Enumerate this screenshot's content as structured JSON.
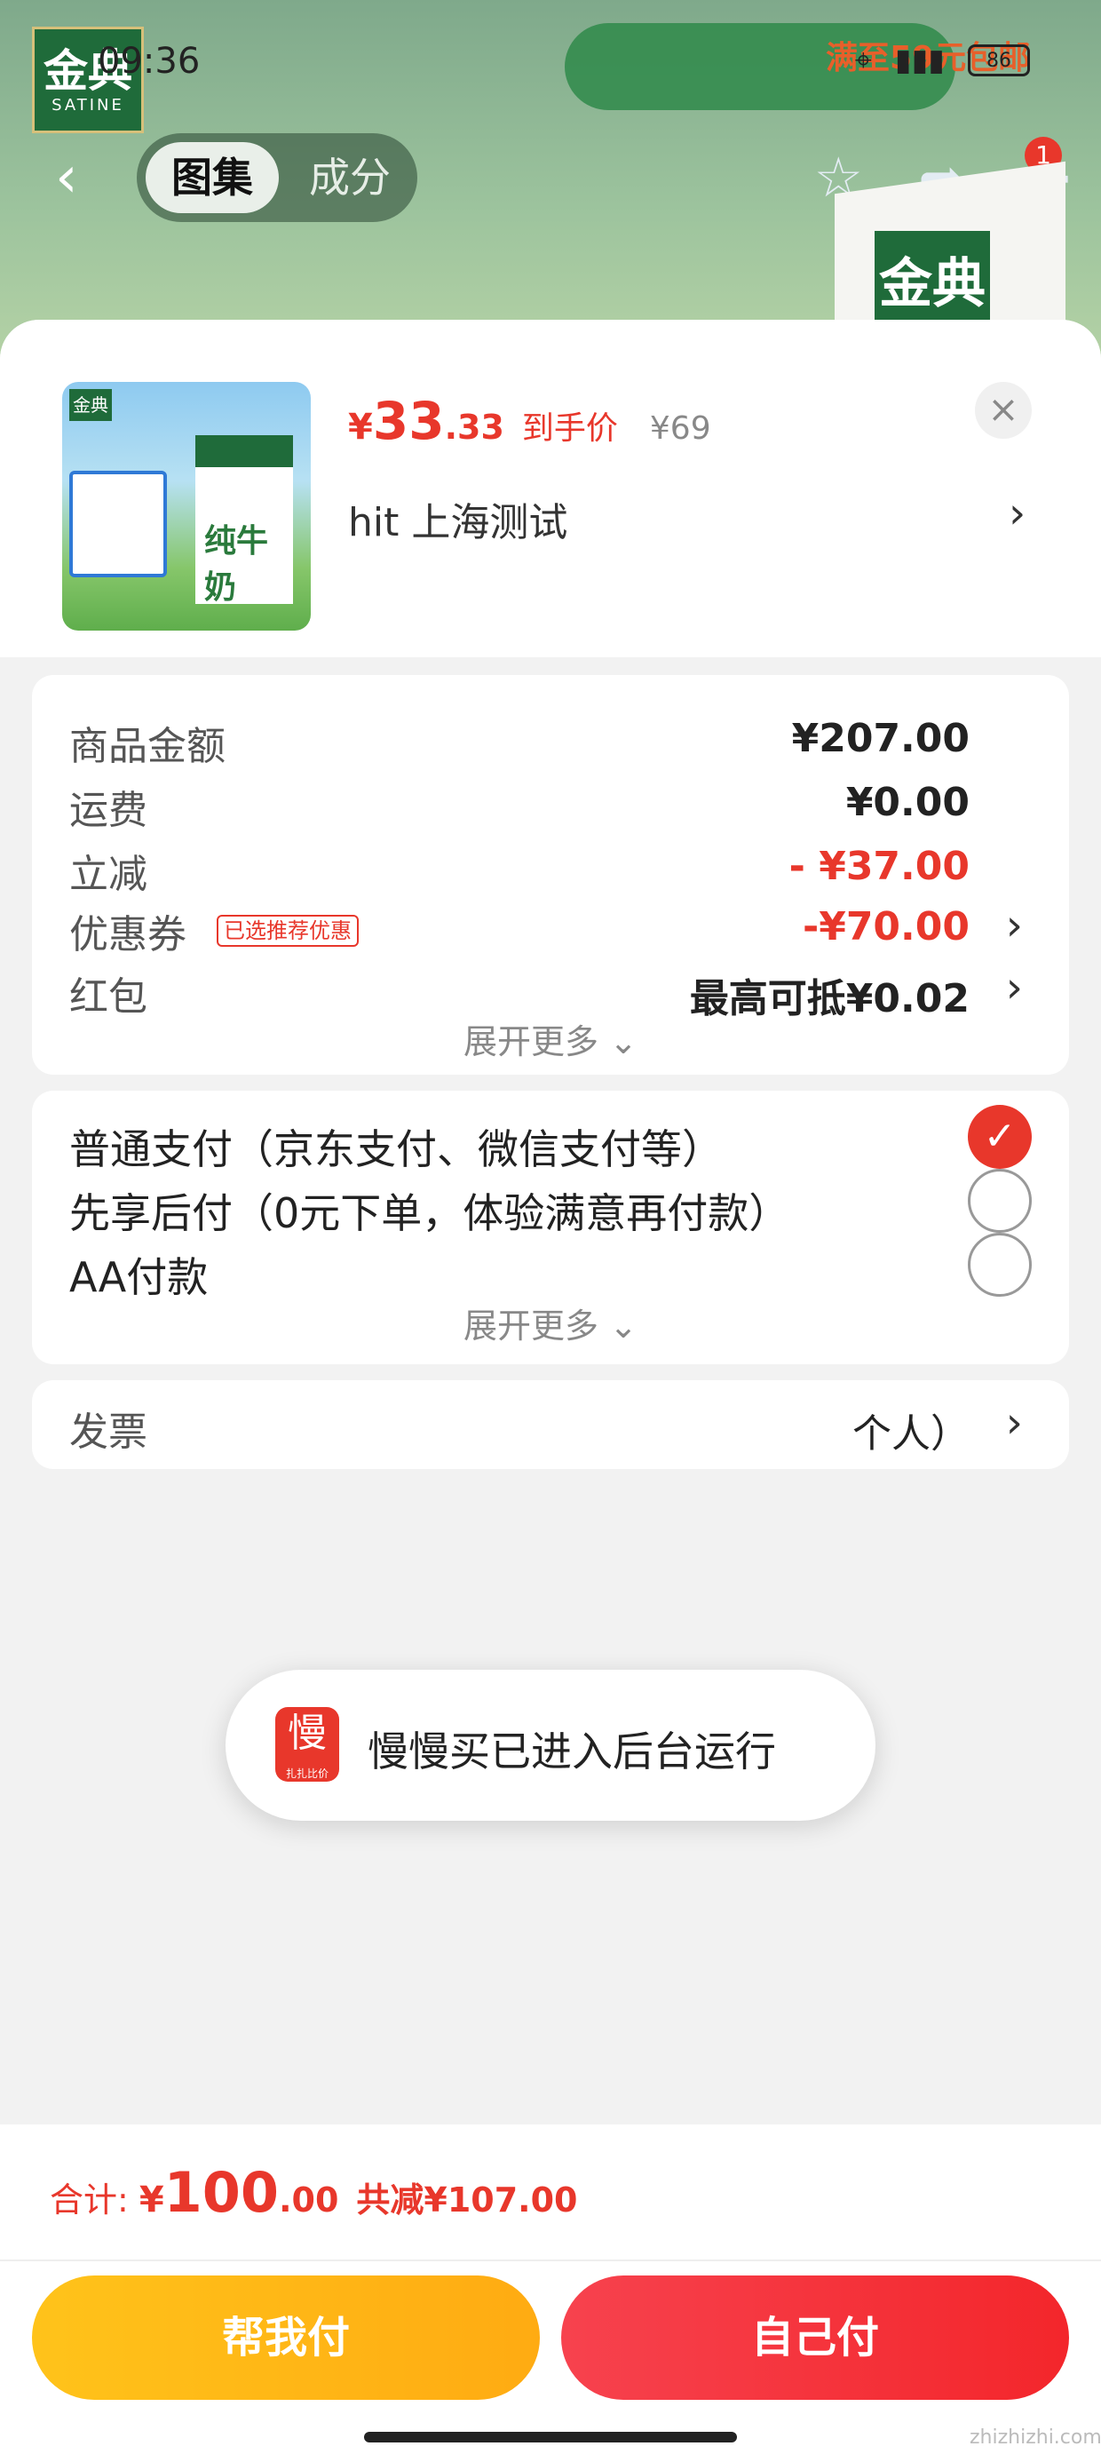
{
  "status_bar": {
    "time": "09:36",
    "battery": "86",
    "colors": {
      "text": "#222222"
    }
  },
  "background": {
    "brand_logo_cn": "金典",
    "brand_logo_en": "SATINE",
    "promo_text": "满至59元包邮",
    "pack_label": "金典",
    "top_tabs": [
      {
        "label": "图集",
        "active": true
      },
      {
        "label": "成分",
        "active": false
      }
    ],
    "cart_badge": "1"
  },
  "product": {
    "price_symbol": "¥",
    "price_int": "33",
    "price_dec": ".33",
    "price_tag": "到手价",
    "original_price": "¥69",
    "address": "hit  上海测试",
    "thumb_label": "纯牛奶",
    "thumb_logo": "金典"
  },
  "costs": {
    "rows": [
      {
        "label": "商品金额",
        "value": "¥207.00"
      },
      {
        "label": "运费",
        "value": "¥0.00"
      },
      {
        "label": "立减",
        "value": "- ¥37.00"
      },
      {
        "label": "优惠券",
        "tag": "已选推荐优惠",
        "value": "-¥70.00"
      },
      {
        "label": "红包",
        "value": "最高可抵¥0.02"
      }
    ],
    "expand_label": "展开更多"
  },
  "payment": {
    "options": [
      {
        "label": "普通支付（京东支付、微信支付等）",
        "selected": true
      },
      {
        "label": "先享后付（0元下单，体验满意再付款）",
        "selected": false
      },
      {
        "label": "AA付款",
        "selected": false
      }
    ],
    "expand_label": "展开更多"
  },
  "invoice": {
    "label": "发票",
    "value": "个人）"
  },
  "toast": {
    "text": "慢慢买已进入后台运行",
    "icon_char": "慢",
    "icon_sub": "扎扎比价"
  },
  "footer": {
    "total_label": "合计:",
    "total_symbol": "¥",
    "total_int": "100",
    "total_dec": ".00",
    "saved": "共减¥107.00",
    "help_pay_label": "帮我付",
    "self_pay_label": "自己付",
    "watermark": "zhizhizhi.com"
  },
  "theme": {
    "accent_red": "#e8372b",
    "accent_yellow": "#ffb514"
  }
}
